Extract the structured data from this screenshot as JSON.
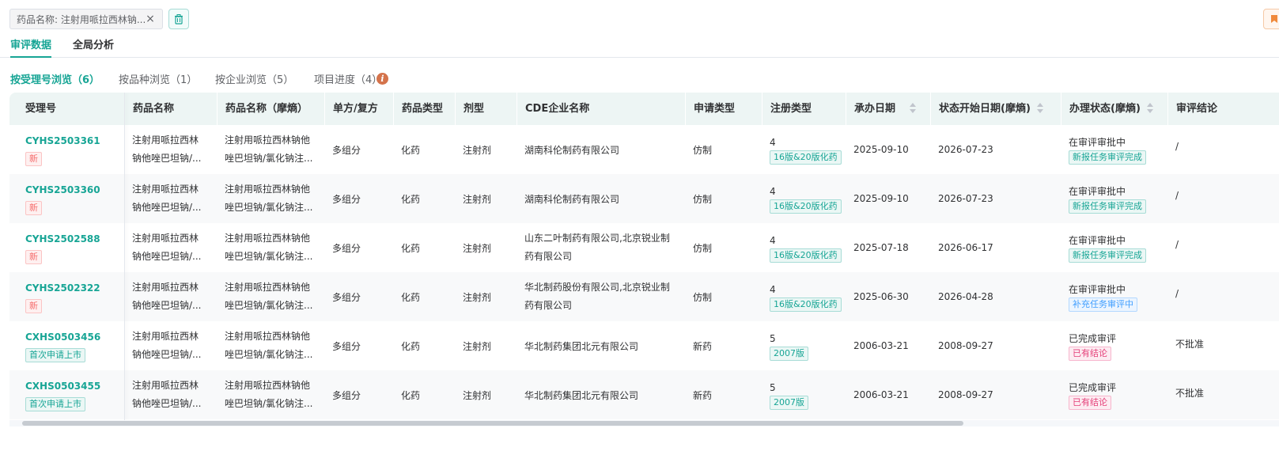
{
  "filter": {
    "text": "药品名称: 注射用哌拉西林钠...",
    "close": "×"
  },
  "main_tabs": [
    {
      "label": "审评数据"
    },
    {
      "label": "全局分析"
    }
  ],
  "sub_tabs": [
    {
      "label": "按受理号浏览（6）"
    },
    {
      "label": "按品种浏览（1）"
    },
    {
      "label": "按企业浏览（5）"
    },
    {
      "label": "项目进度（4）"
    }
  ],
  "info_badge": "i",
  "table": {
    "headers": [
      "受理号",
      "药品名称",
      "药品名称（摩熵）",
      "单方/复方",
      "药品类型",
      "剂型",
      "CDE企业名称",
      "申请类型",
      "注册类型",
      "承办日期",
      "状态开始日期(摩熵)",
      "办理状态(摩熵)",
      "审评结论"
    ],
    "rows": [
      {
        "acc": "CYHS2503361",
        "acc_tag": "新",
        "name1": "注射用哌拉西林",
        "name2": "钠他唑巴坦钠/...",
        "mname1": "注射用哌拉西林钠他",
        "mname2": "唑巴坦钠/氯化钠注...",
        "combo": "多组分",
        "dtype": "化药",
        "form": "注射剂",
        "company1": "湖南科伦制药有限公司",
        "company2": "",
        "apptype": "仿制",
        "reg": "4",
        "reg_tag": "16版&20版化药",
        "date1": "2025-09-10",
        "date2": "2026-07-23",
        "status": "在审评审批中",
        "status_tag": "新报任务审评完成",
        "status_color": "green",
        "conclusion": "/"
      },
      {
        "acc": "CYHS2503360",
        "acc_tag": "新",
        "name1": "注射用哌拉西林",
        "name2": "钠他唑巴坦钠/...",
        "mname1": "注射用哌拉西林钠他",
        "mname2": "唑巴坦钠/氯化钠注...",
        "combo": "多组分",
        "dtype": "化药",
        "form": "注射剂",
        "company1": "湖南科伦制药有限公司",
        "company2": "",
        "apptype": "仿制",
        "reg": "4",
        "reg_tag": "16版&20版化药",
        "date1": "2025-09-10",
        "date2": "2026-07-23",
        "status": "在审评审批中",
        "status_tag": "新报任务审评完成",
        "status_color": "green",
        "conclusion": "/"
      },
      {
        "acc": "CYHS2502588",
        "acc_tag": "新",
        "name1": "注射用哌拉西林",
        "name2": "钠他唑巴坦钠/...",
        "mname1": "注射用哌拉西林钠他",
        "mname2": "唑巴坦钠/氯化钠注...",
        "combo": "多组分",
        "dtype": "化药",
        "form": "注射剂",
        "company1": "山东二叶制药有限公司,北京锐业制",
        "company2": "药有限公司",
        "apptype": "仿制",
        "reg": "4",
        "reg_tag": "16版&20版化药",
        "date1": "2025-07-18",
        "date2": "2026-06-17",
        "status": "在审评审批中",
        "status_tag": "新报任务审评完成",
        "status_color": "green",
        "conclusion": "/"
      },
      {
        "acc": "CYHS2502322",
        "acc_tag": "新",
        "name1": "注射用哌拉西林",
        "name2": "钠他唑巴坦钠/...",
        "mname1": "注射用哌拉西林钠他",
        "mname2": "唑巴坦钠/氯化钠注...",
        "combo": "多组分",
        "dtype": "化药",
        "form": "注射剂",
        "company1": "华北制药股份有限公司,北京锐业制",
        "company2": "药有限公司",
        "apptype": "仿制",
        "reg": "4",
        "reg_tag": "16版&20版化药",
        "date1": "2025-06-30",
        "date2": "2026-04-28",
        "status": "在审评审批中",
        "status_tag": "补充任务审评中",
        "status_color": "blue",
        "conclusion": "/"
      },
      {
        "acc": "CXHS0503456",
        "acc_tag": "首次申请上市",
        "name1": "注射用哌拉西林",
        "name2": "钠他唑巴坦钠/...",
        "mname1": "注射用哌拉西林钠他",
        "mname2": "唑巴坦钠/氯化钠注...",
        "combo": "多组分",
        "dtype": "化药",
        "form": "注射剂",
        "company1": "华北制药集团北元有限公司",
        "company2": "",
        "apptype": "新药",
        "reg": "5",
        "reg_tag": "2007版",
        "date1": "2006-03-21",
        "date2": "2008-09-27",
        "status": "已完成审评",
        "status_tag": "已有结论",
        "status_color": "pink",
        "conclusion": "不批准"
      },
      {
        "acc": "CXHS0503455",
        "acc_tag": "首次申请上市",
        "name1": "注射用哌拉西林",
        "name2": "钠他唑巴坦钠/...",
        "mname1": "注射用哌拉西林钠他",
        "mname2": "唑巴坦钠/氯化钠注...",
        "combo": "多组分",
        "dtype": "化药",
        "form": "注射剂",
        "company1": "华北制药集团北元有限公司",
        "company2": "",
        "apptype": "新药",
        "reg": "5",
        "reg_tag": "2007版",
        "date1": "2006-03-21",
        "date2": "2008-09-27",
        "status": "已完成审评",
        "status_tag": "已有结论",
        "status_color": "pink",
        "conclusion": "不批准"
      }
    ]
  },
  "colors": {
    "accent": "#17a595",
    "new_tag": "#f56c6c",
    "blue_tag": "#409eff",
    "pink_tag": "#e5407a"
  },
  "icons": {
    "trash": "trash-icon",
    "bookmark": "bookmark-icon",
    "close": "close-icon",
    "info": "info-icon"
  }
}
